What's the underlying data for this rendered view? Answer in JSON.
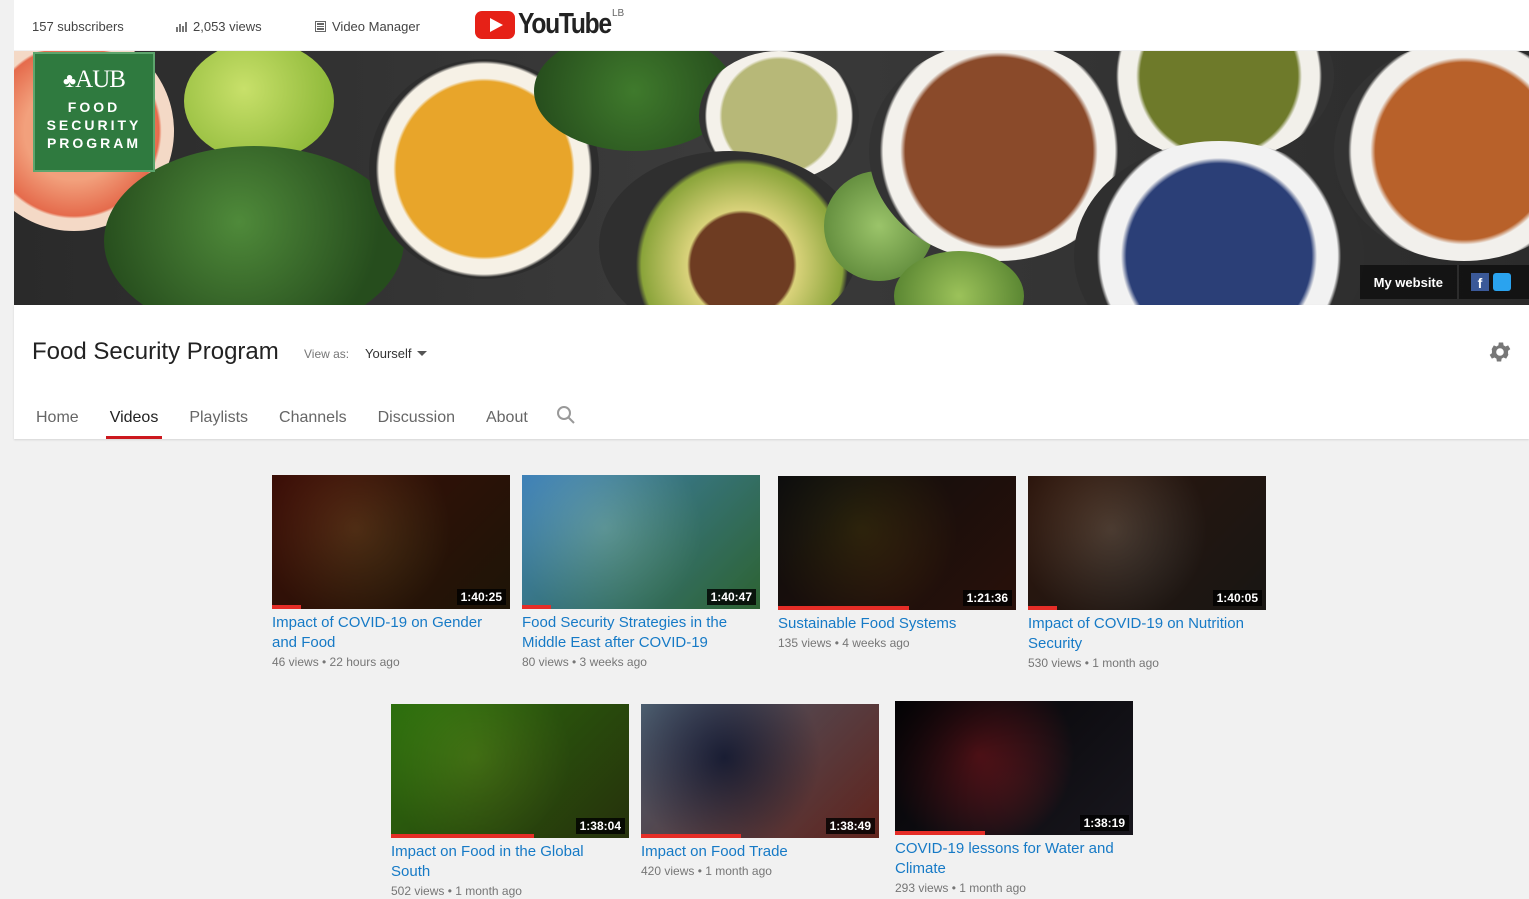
{
  "topbar": {
    "subscribers": "157 subscribers",
    "views": "2,053 views",
    "video_manager": "Video Manager",
    "logo_word": "YouTube",
    "logo_country": "LB"
  },
  "banner": {
    "logo_top": "AUB",
    "logo_lines": [
      "FOOD",
      "SECURITY",
      "PROGRAM"
    ],
    "my_website": "My website",
    "facebook_glyph": "f"
  },
  "channel": {
    "title": "Food Security Program",
    "view_as_label": "View as:",
    "view_as_value": "Yourself"
  },
  "tabs": [
    "Home",
    "Videos",
    "Playlists",
    "Channels",
    "Discussion",
    "About"
  ],
  "active_tab": "Videos",
  "videos": [
    {
      "title_1": "Impact of COVID-19 on Gender",
      "title_2": "and Food",
      "meta": "46 views  •  22 hours ago",
      "duration": "1:40:25",
      "watched": 0.12,
      "palette": [
        "#7a3b2a",
        "#c9a27a",
        "#3e5a2b"
      ]
    },
    {
      "title_1": "Food Security Strategies in the",
      "title_2": "Middle East after COVID-19",
      "meta": "80 views  •  3 weeks ago",
      "duration": "1:40:47",
      "watched": 0.12,
      "palette": [
        "#7fb6d9",
        "#cfe3ef",
        "#5a8a3a"
      ]
    },
    {
      "title_1": "Sustainable Food Systems",
      "title_2": "",
      "meta": "135 views  •  4 weeks ago",
      "duration": "1:21:36",
      "watched": 0.55,
      "palette": [
        "#3a3a3a",
        "#6f8c3b",
        "#b2482d"
      ]
    },
    {
      "title_1": "Impact of COVID-19 on Nutrition",
      "title_2": "Security",
      "meta": "530 views  •  1 month ago",
      "duration": "1:40:05",
      "watched": 0.12,
      "palette": [
        "#6b4b3a",
        "#d8cbb8",
        "#3a4a55"
      ]
    },
    {
      "title_1": "Impact on Food in the Global",
      "title_2": "South",
      "meta": "502 views  •  1 month ago",
      "duration": "1:38:04",
      "watched": 0.6,
      "palette": [
        "#6aa83a",
        "#a5d25a",
        "#5b4a35"
      ]
    },
    {
      "title_1": "Impact on Food Trade",
      "title_2": "",
      "meta": "420 views  •  1 month ago",
      "duration": "1:38:49",
      "watched": 0.42,
      "palette": [
        "#8a9aa8",
        "#2a3e6b",
        "#b23a2a"
      ]
    },
    {
      "title_1": "COVID-19 lessons for Water and",
      "title_2": "Climate",
      "meta": "293 views  •  1 month ago",
      "duration": "1:38:19",
      "watched": 0.38,
      "palette": [
        "#1c1a22",
        "#c22a35",
        "#dcdcdc"
      ]
    }
  ],
  "colors": {
    "youtube_red": "#e62117",
    "tab_underline": "#cc181e",
    "link_blue": "#167ac6",
    "aub_green": "#2f7a3f"
  }
}
